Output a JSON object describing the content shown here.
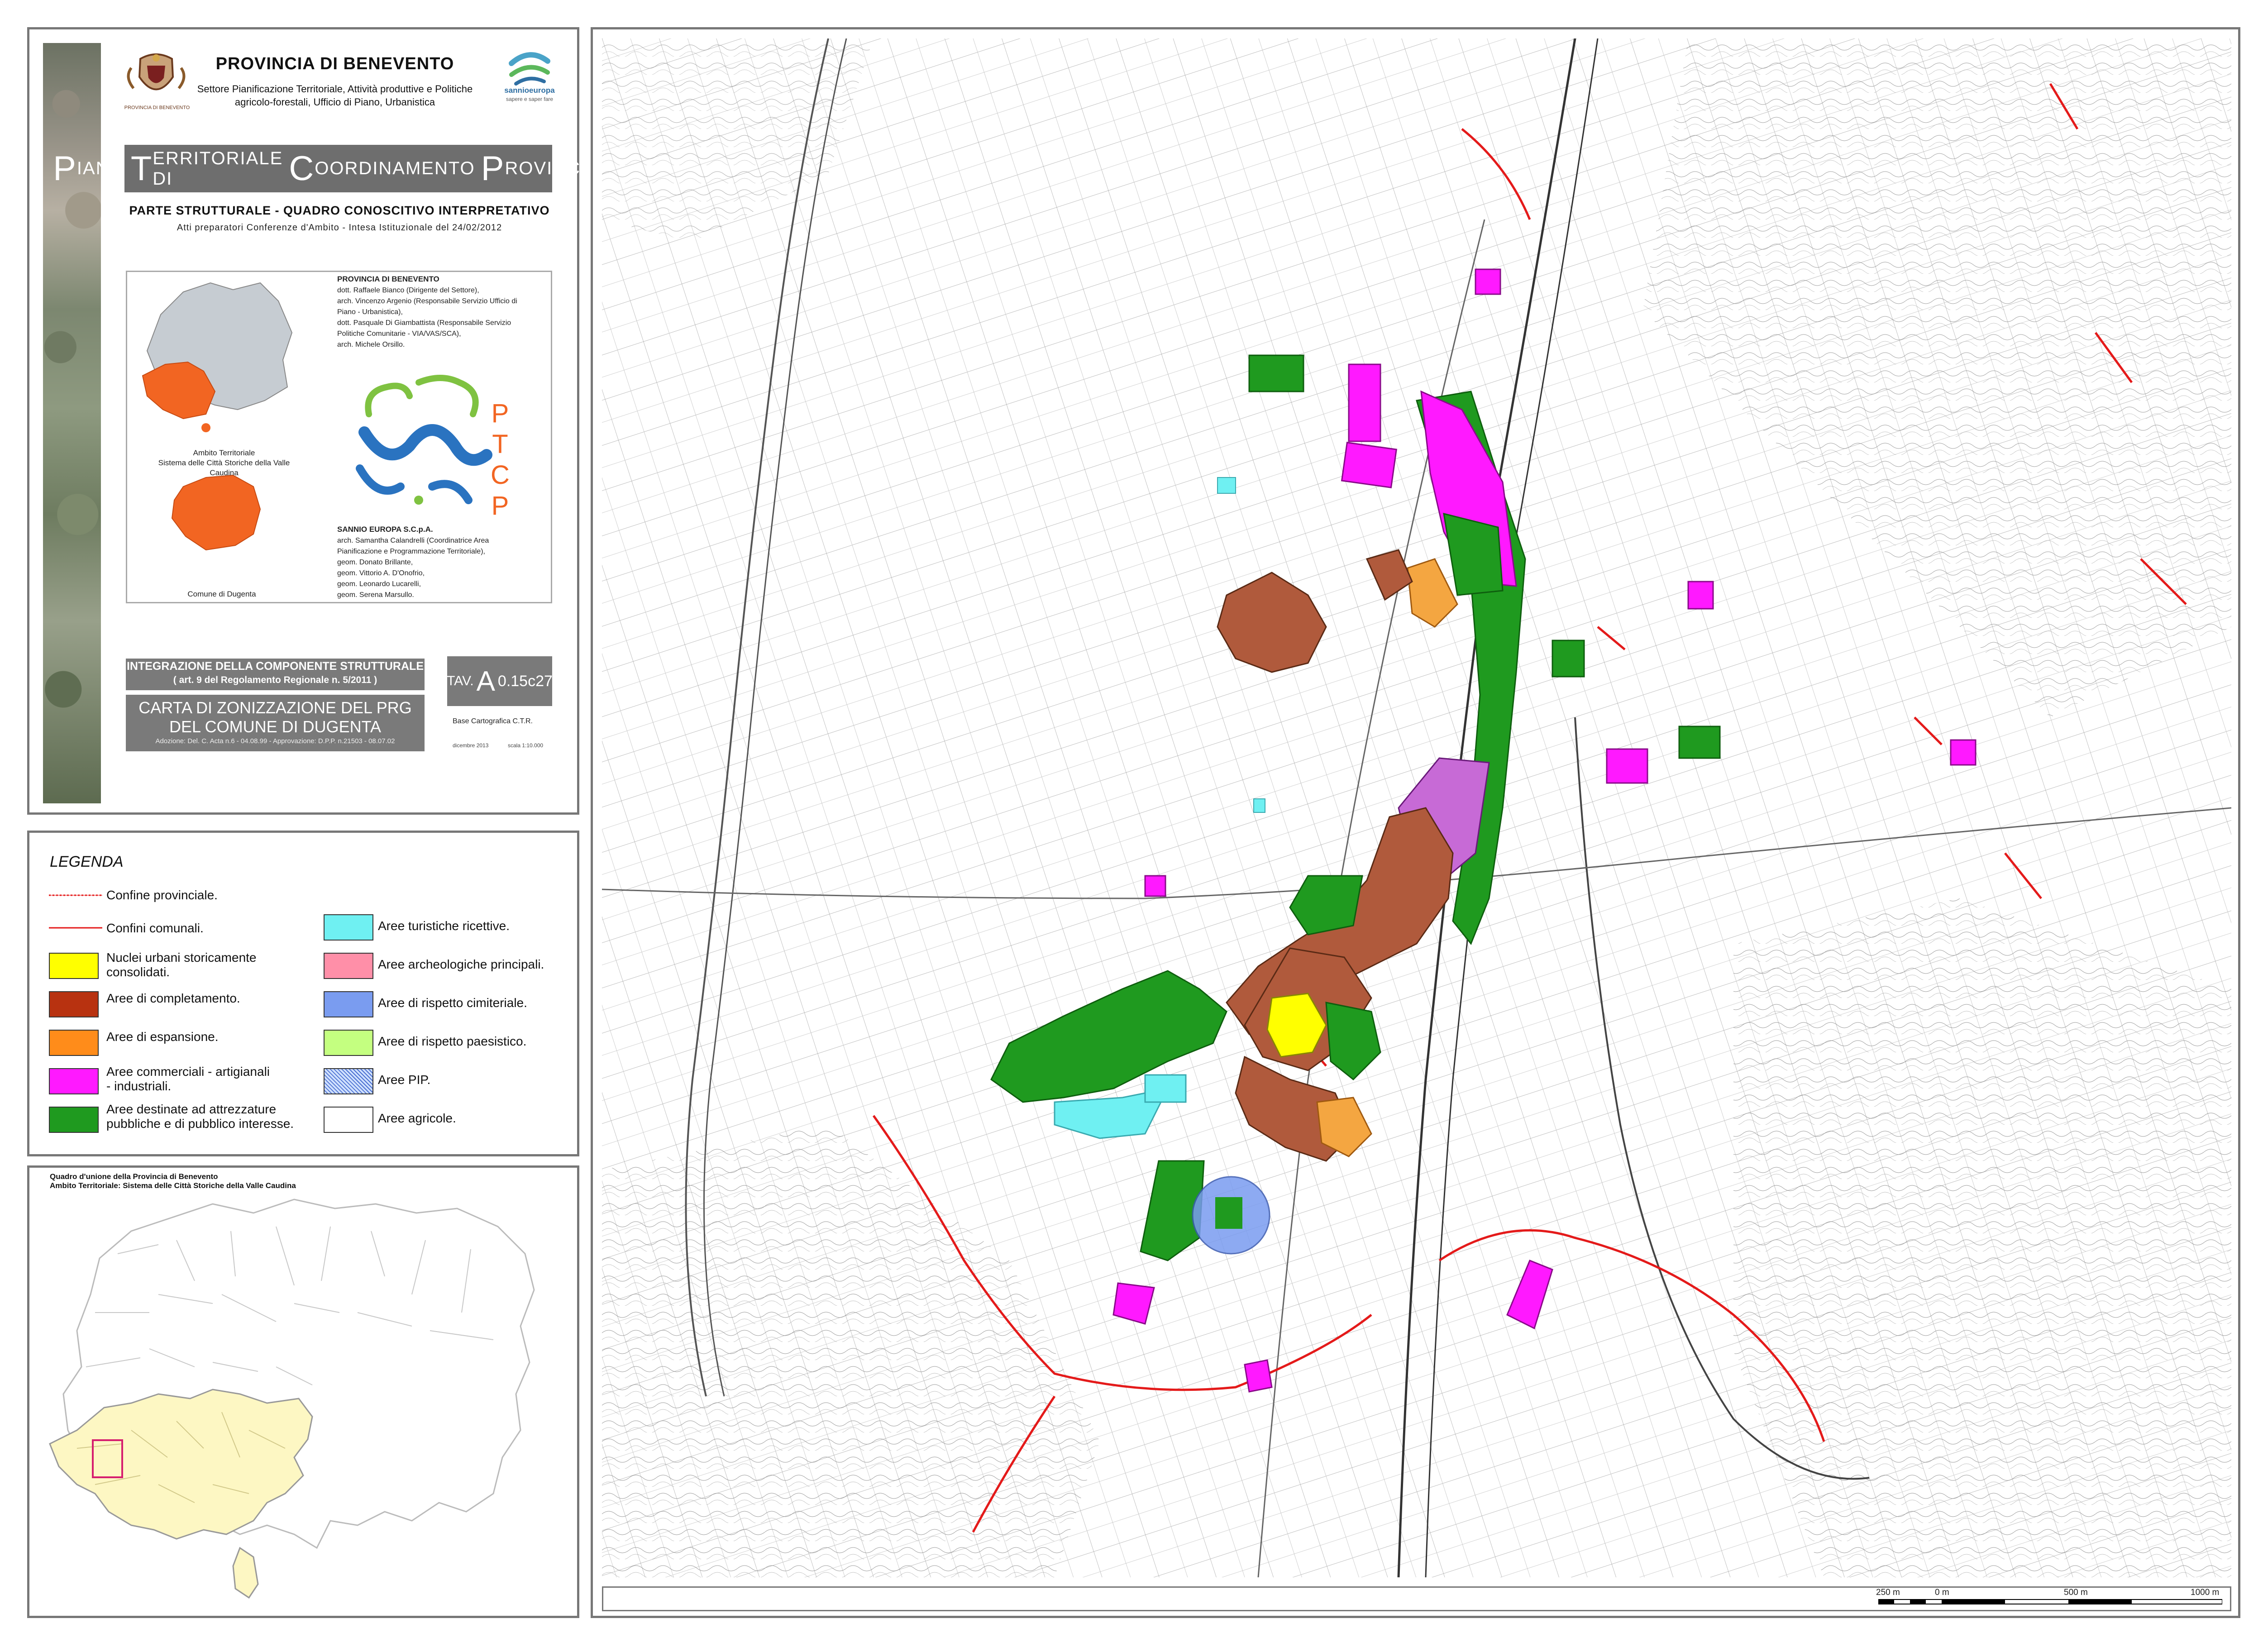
{
  "header": {
    "province": "PROVINCIA DI BENEVENTO",
    "department": "Settore Pianificazione Territoriale, Attività produttive e Politiche agricolo-forestali, Ufficio di Piano, Urbanistica",
    "crest_caption": "PROVINCIA DI BENEVENTO",
    "partner_logo": "sannioeuropa",
    "partner_tagline": "sapere e saper fare"
  },
  "plan": {
    "banner_initials": [
      "P",
      "T",
      "C",
      "P"
    ],
    "banner_words": [
      "IANO",
      "ERRITORIALE DI",
      "OORDINAMENTO",
      "ROVINCIALE"
    ],
    "part": "PARTE STRUTTURALE - QUADRO CONOSCITIVO INTERPRETATIVO",
    "acts": "Atti preparatori Conferenze d'Ambito - Intesa Istituzionale del 24/02/2012"
  },
  "credits": {
    "org1": "PROVINCIA DI BENEVENTO",
    "org1_people": [
      "dott. Raffaele Bianco (Dirigente del Settore),",
      "arch. Vincenzo Argenio (Responsabile Servizio Ufficio di",
      "Piano - Urbanistica),",
      "dott. Pasquale Di Giambattista (Responsabile Servizio",
      "Politiche Comunitarie - VIA/VAS/SCA),",
      "arch. Michele Orsillo."
    ],
    "org2": "SANNIO EUROPA S.C.p.A.",
    "org2_people": [
      "arch. Samantha Calandrelli (Coordinatrice Area",
      "Pianificazione e Programmazione Territoriale),",
      "geom. Donato Brillante,",
      "geom. Vittorio A. D'Onofrio,",
      "geom. Leonardo Lucarelli,",
      "geom. Serena Marsullo."
    ],
    "ambito_caption_1": "Ambito Territoriale",
    "ambito_caption_2": "Sistema delle Città Storiche della Valle Caudina",
    "comune_caption": "Comune di Dugenta",
    "ptcp_letters": [
      "P",
      "T",
      "C",
      "P"
    ]
  },
  "sheet": {
    "integration_title": "INTEGRAZIONE DELLA COMPONENTE STRUTTURALE",
    "integration_ref": "( art. 9 del Regolamento Regionale n. 5/2011 )",
    "map_title_1": "CARTA DI ZONIZZAZIONE DEL PRG",
    "map_title_2": "DEL COMUNE DI DUGENTA",
    "adoption": "Adozione: Del. C. Acta n.6 - 04.08.99 - Approvazione: D.P.P. n.21503 - 08.07.02",
    "tav_prefix": "TAV.",
    "tav_code_big": "A",
    "tav_code_rest": "0.15c27",
    "base": "Base Cartografica C.T.R.",
    "date": "dicembre 2013",
    "scale": "scala 1:10.000"
  },
  "legend": {
    "title": "LEGENDA",
    "boundaries": [
      {
        "label": "Confine provinciale.",
        "color": "#e41a1a"
      },
      {
        "label": "Confini comunali.",
        "color": "#e41a1a"
      }
    ],
    "left_items": [
      {
        "label_1": "Nuclei urbani storicamente",
        "label_2": "consolidati.",
        "color": "#ffff00"
      },
      {
        "label_1": "Aree di completamento.",
        "label_2": "",
        "color": "#b83210"
      },
      {
        "label_1": "Aree di espansione.",
        "label_2": "",
        "color": "#ff8c1a"
      },
      {
        "label_1": "Aree commerciali - artigianali",
        "label_2": "- industriali.",
        "color": "#ff19ff"
      },
      {
        "label_1": "Aree destinate ad attrezzature",
        "label_2": "pubbliche e di pubblico interesse.",
        "color": "#1f9a1f"
      }
    ],
    "right_items": [
      {
        "label": "Aree turistiche ricettive.",
        "color": "#6ff0f2"
      },
      {
        "label": "Aree archeologiche principali.",
        "color": "#ff8fa8"
      },
      {
        "label": "Aree di rispetto cimiteriale.",
        "color": "#7a9cf0"
      },
      {
        "label": "Aree di rispetto paesistico.",
        "color": "#c4ff80"
      },
      {
        "label": "Aree PIP.",
        "color": "#cfe0ff"
      },
      {
        "label": "Aree agricole.",
        "color": "#ffffff"
      }
    ]
  },
  "overview": {
    "title_1": "Quadro d'unione della Provincia di Benevento",
    "title_2": "Ambito Territoriale: Sistema delle Città Storiche della Valle Caudina"
  },
  "scalebar": {
    "labels": [
      "250 m",
      "0 m",
      "500 m",
      "1000 m"
    ]
  }
}
